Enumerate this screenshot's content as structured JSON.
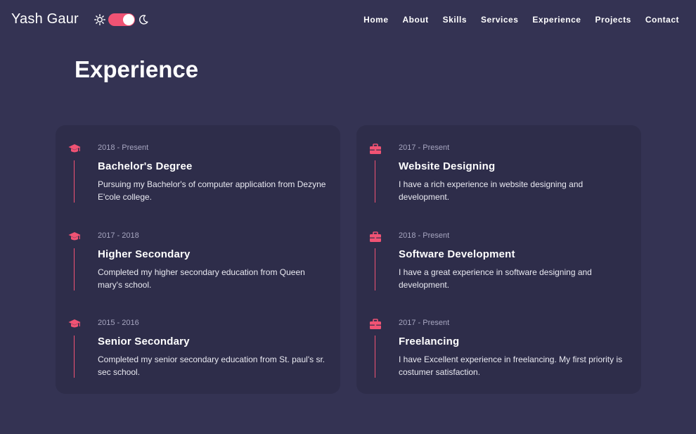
{
  "brand": "Yash Gaur",
  "nav": [
    "Home",
    "About",
    "Skills",
    "Services",
    "Experience",
    "Projects",
    "Contact"
  ],
  "theme_toggle": {
    "sun_icon": "sun-icon",
    "moon_icon": "moon-icon",
    "state": "on"
  },
  "section_title": "Experience",
  "colors": {
    "background": "#343353",
    "card": "#2e2d4a",
    "accent": "#f05374",
    "muted": "#a7a6c0"
  },
  "education": [
    {
      "icon": "graduation-cap-icon",
      "date": "2018 - Present",
      "title": "Bachelor's Degree",
      "desc": "Pursuing my Bachelor's of computer application from Dezyne E'cole college."
    },
    {
      "icon": "graduation-cap-icon",
      "date": "2017 - 2018",
      "title": "Higher Secondary",
      "desc": "Completed my higher secondary education from Queen mary's school."
    },
    {
      "icon": "graduation-cap-icon",
      "date": "2015 - 2016",
      "title": "Senior Secondary",
      "desc": "Completed my senior secondary education from St. paul's sr. sec school."
    }
  ],
  "work": [
    {
      "icon": "briefcase-icon",
      "date": "2017 - Present",
      "title": "Website Designing",
      "desc": "I have a rich experience in website designing and development."
    },
    {
      "icon": "briefcase-icon",
      "date": "2018 - Present",
      "title": "Software Development",
      "desc": "I have a great experience in software designing and development."
    },
    {
      "icon": "briefcase-icon",
      "date": "2017 - Present",
      "title": "Freelancing",
      "desc": "I have Excellent experience in freelancing. My first priority is costumer satisfaction."
    }
  ]
}
